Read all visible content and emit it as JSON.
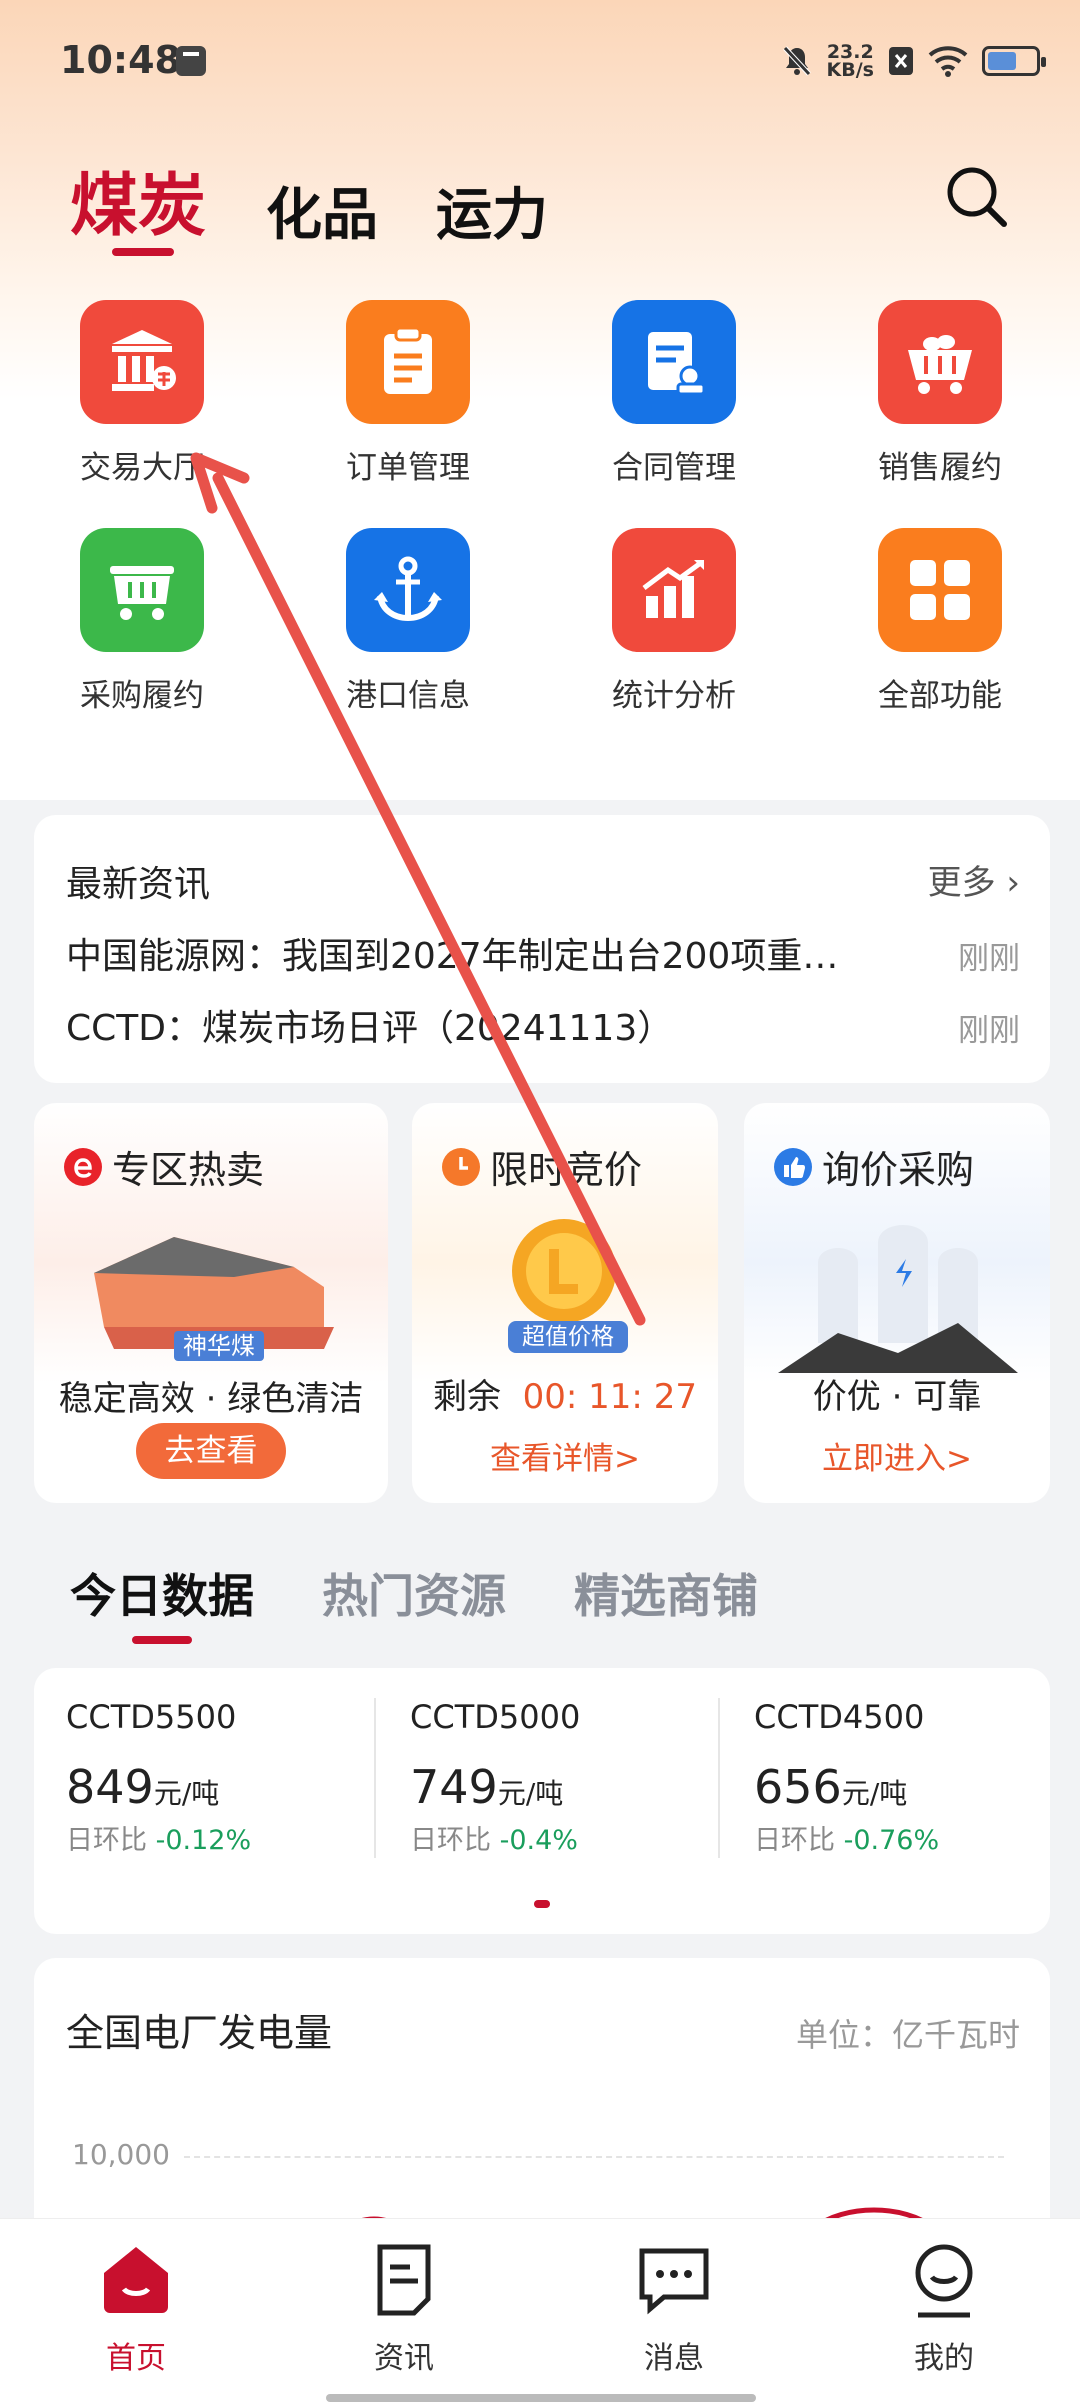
{
  "status": {
    "time": "10:48",
    "net_speed": "23.2",
    "net_unit": "KB/s"
  },
  "top_tabs": [
    {
      "label": "煤炭"
    },
    {
      "label": "化品"
    },
    {
      "label": "运力"
    }
  ],
  "grid": [
    {
      "label": "交易大厅",
      "icon": "trading-hall-icon",
      "color": "#f04a3c"
    },
    {
      "label": "订单管理",
      "icon": "clipboard-icon",
      "color": "#fa7d1e"
    },
    {
      "label": "合同管理",
      "icon": "contract-icon",
      "color": "#1673e6"
    },
    {
      "label": "销售履约",
      "icon": "cart-icon",
      "color": "#f04a3c"
    },
    {
      "label": "采购履约",
      "icon": "mine-cart-icon",
      "color": "#3cb84a"
    },
    {
      "label": "港口信息",
      "icon": "anchor-icon",
      "color": "#1673e6"
    },
    {
      "label": "统计分析",
      "icon": "bar-chart-icon",
      "color": "#f04a3c"
    },
    {
      "label": "全部功能",
      "icon": "grid-icon",
      "color": "#fa7d1e"
    }
  ],
  "news": {
    "title": "最新资讯",
    "more": "更多",
    "items": [
      {
        "text": "中国能源网：我国到2027年制定出台200项重…",
        "time": "刚刚"
      },
      {
        "text": "CCTD：煤炭市场日评（20241113）",
        "time": "刚刚"
      }
    ]
  },
  "promos": [
    {
      "title": "专区热卖",
      "badge": "神华煤",
      "sub": "稳定高效 · 绿色清洁",
      "button": "去查看"
    },
    {
      "title": "限时竞价",
      "badge": "超值价格",
      "remain_label": "剩余",
      "countdown": "00: 11: 27",
      "link": "查看详情>"
    },
    {
      "title": "询价采购",
      "sub": "价优 · 可靠",
      "link": "立即进入>"
    }
  ],
  "data_tabs": [
    {
      "label": "今日数据"
    },
    {
      "label": "热门资源"
    },
    {
      "label": "精选商铺"
    }
  ],
  "data_cards": [
    {
      "name": "CCTD5500",
      "price": "849",
      "unit": "元/吨",
      "change_label": "日环比",
      "change": "-0.12%"
    },
    {
      "name": "CCTD5000",
      "price": "749",
      "unit": "元/吨",
      "change_label": "日环比",
      "change": "-0.4%"
    },
    {
      "name": "CCTD4500",
      "price": "656",
      "unit": "元/吨",
      "change_label": "日环比",
      "change": "-0.76%"
    }
  ],
  "chart_card": {
    "title": "全国电厂发电量",
    "unit": "单位：亿千瓦时",
    "y_tick": "10,000"
  },
  "bottom_nav": [
    {
      "label": "首页",
      "icon": "home-icon"
    },
    {
      "label": "资讯",
      "icon": "news-icon"
    },
    {
      "label": "消息",
      "icon": "message-icon"
    },
    {
      "label": "我的",
      "icon": "profile-icon"
    }
  ],
  "colors": {
    "brand": "#c8102e",
    "accent": "#e8562a",
    "down": "#1a9e5c"
  }
}
